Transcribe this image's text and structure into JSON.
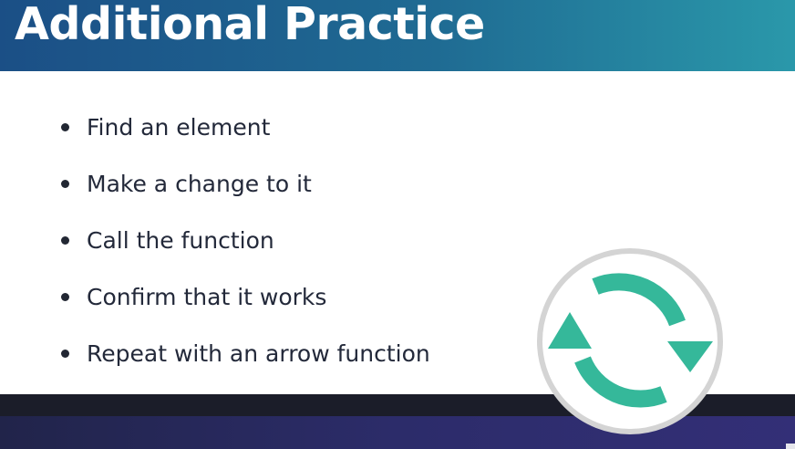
{
  "slide": {
    "title": "Additional Practice",
    "bullets": [
      {
        "text": "Find an element"
      },
      {
        "text": "Make a change to it"
      },
      {
        "text": "Call the function"
      },
      {
        "text": "Confirm that it works"
      },
      {
        "text": "Repeat with an arrow function"
      }
    ],
    "icon": "refresh-cycle-icon"
  },
  "colors": {
    "header_start": "#1b4f86",
    "header_end": "#2a98aa",
    "accent_teal": "#35b89a",
    "text": "#23293a",
    "footer": "#2c2c6a"
  }
}
